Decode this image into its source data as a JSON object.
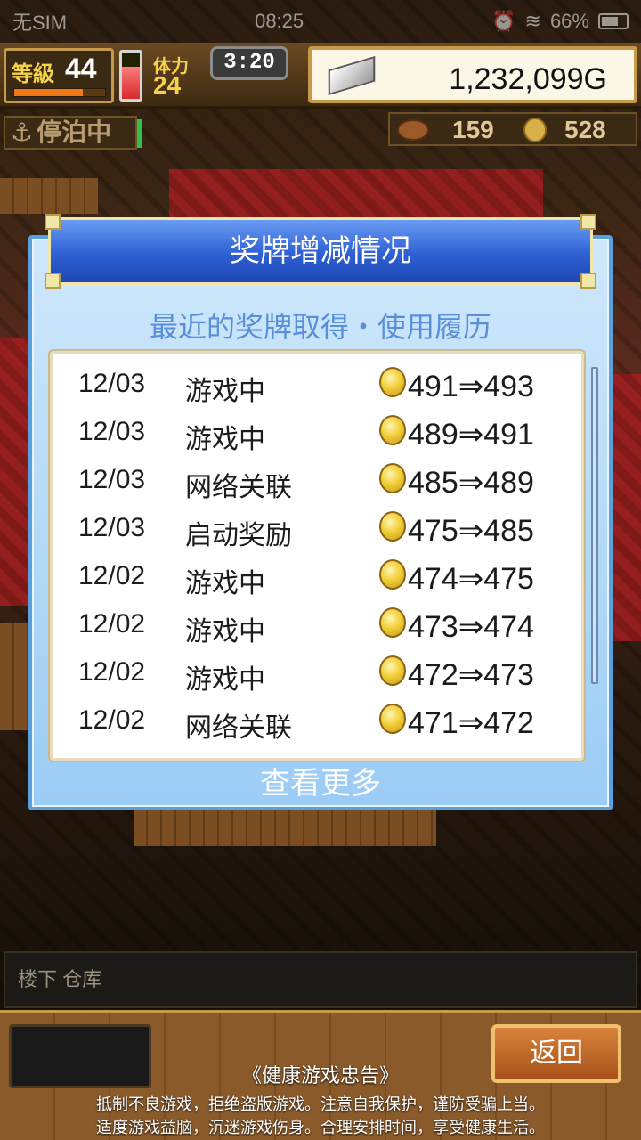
{
  "status_bar": {
    "carrier": "无SIM",
    "time": "08:25",
    "battery": "66%"
  },
  "hud": {
    "level_label": "等級",
    "level_value": "44",
    "exp_fraction": 0.75,
    "stamina_label": "体力",
    "stamina_value": "24",
    "stamina_fraction": 0.7,
    "timer": "3:20",
    "gold": "1,232,099G",
    "anchor_status": "停泊中",
    "resource_a": "159",
    "resource_b": "528"
  },
  "modal": {
    "title": "奖牌增减情况",
    "subtitle": "最近的奖牌取得・使用履历",
    "rows": [
      {
        "date": "12/03",
        "type": "游戏中",
        "change": "491⇒493"
      },
      {
        "date": "12/03",
        "type": "游戏中",
        "change": "489⇒491"
      },
      {
        "date": "12/03",
        "type": "网络关联",
        "change": "485⇒489"
      },
      {
        "date": "12/03",
        "type": "启动奖励",
        "change": "475⇒485"
      },
      {
        "date": "12/02",
        "type": "游戏中",
        "change": "474⇒475"
      },
      {
        "date": "12/02",
        "type": "游戏中",
        "change": "473⇒474"
      },
      {
        "date": "12/02",
        "type": "游戏中",
        "change": "472⇒473"
      },
      {
        "date": "12/02",
        "type": "网络关联",
        "change": "471⇒472"
      }
    ],
    "more_label": "查看更多"
  },
  "bottom": {
    "location": "楼下 仓库",
    "back_label": "返回",
    "notice_title": "《健康游戏忠告》",
    "notice_line1": "抵制不良游戏，拒绝盗版游戏。注意自我保护，谨防受骗上当。",
    "notice_line2": "适度游戏益脑，沉迷游戏伤身。合理安排时间，享受健康生活。"
  }
}
